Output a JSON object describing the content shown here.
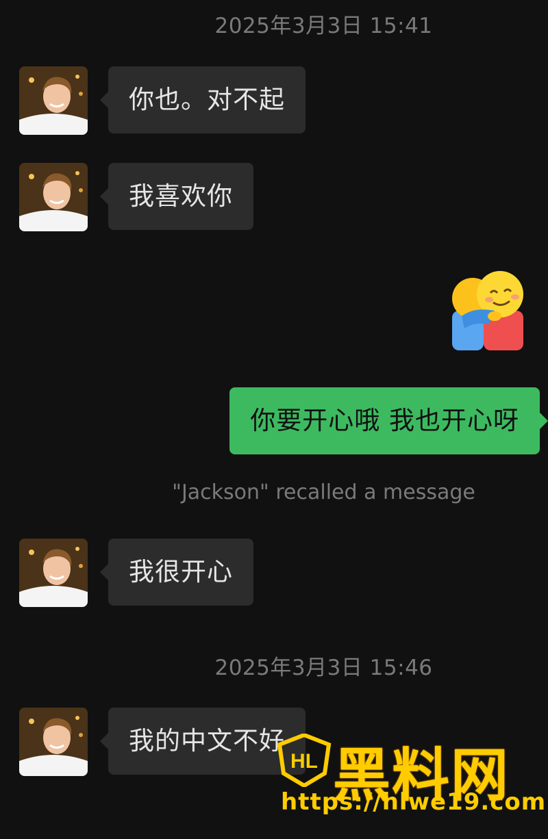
{
  "timestamps": [
    "2025年3月3日 15:41",
    "2025年3月3日 15:46"
  ],
  "messages": [
    {
      "side": "left",
      "text": "你也。对不起"
    },
    {
      "side": "left",
      "text": "我喜欢你"
    },
    {
      "side": "right",
      "sticker": "hug-emoji-sticker"
    },
    {
      "side": "right",
      "text": "你要开心哦 我也开心呀"
    },
    {
      "side": "left",
      "text": "我很开心"
    },
    {
      "side": "left",
      "text": "我的中文不好"
    }
  ],
  "system_notice": "\"Jackson\" recalled a message",
  "watermark": {
    "logo": "HL",
    "title": "黑料网",
    "url": "https://hlwe19.com"
  },
  "colors": {
    "background": "#111111",
    "incoming_bubble": "#2c2c2c",
    "outgoing_bubble": "#3dba60",
    "watermark": "#ffcc00"
  }
}
